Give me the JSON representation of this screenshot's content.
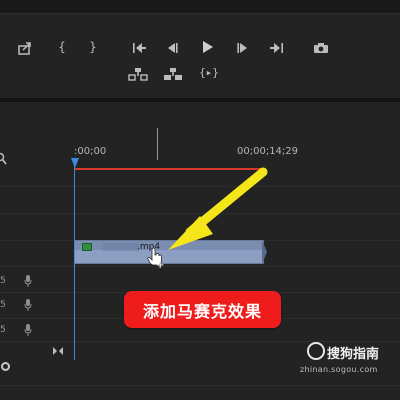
{
  "monitor": {
    "controls_row1": [
      {
        "name": "export-frame-icon"
      },
      {
        "name": "mark-in-icon",
        "glyph": "{"
      },
      {
        "name": "mark-out-icon",
        "glyph": "}"
      },
      {
        "name": "go-to-in-icon"
      },
      {
        "name": "step-back-icon"
      },
      {
        "name": "play-icon"
      },
      {
        "name": "step-forward-icon"
      },
      {
        "name": "go-to-out-icon"
      },
      {
        "name": "camera-icon"
      }
    ],
    "controls_row2": [
      {
        "name": "lift-icon"
      },
      {
        "name": "extract-icon"
      },
      {
        "name": "play-in-to-out-icon",
        "glyph": "{▸}"
      }
    ]
  },
  "timeline": {
    "ruler_start": ":00;00",
    "ruler_mid": "00;00;14;29",
    "track_numbers": [
      "5",
      "5",
      "5"
    ],
    "clip": {
      "name": ".mp4",
      "label_top": "1 ...",
      "fx_color": "#2f8f3f",
      "color": "#8c9fc2"
    },
    "playhead_color": "#3d8be0",
    "work_area_color": "#d43a2a"
  },
  "annotation": {
    "label": "添加马赛克效果",
    "label_color": "#ef1c1c",
    "arrow_color": "#f5e61a"
  },
  "watermark": {
    "brand": "搜狗指南",
    "url": "zhinan.sogou.com"
  }
}
